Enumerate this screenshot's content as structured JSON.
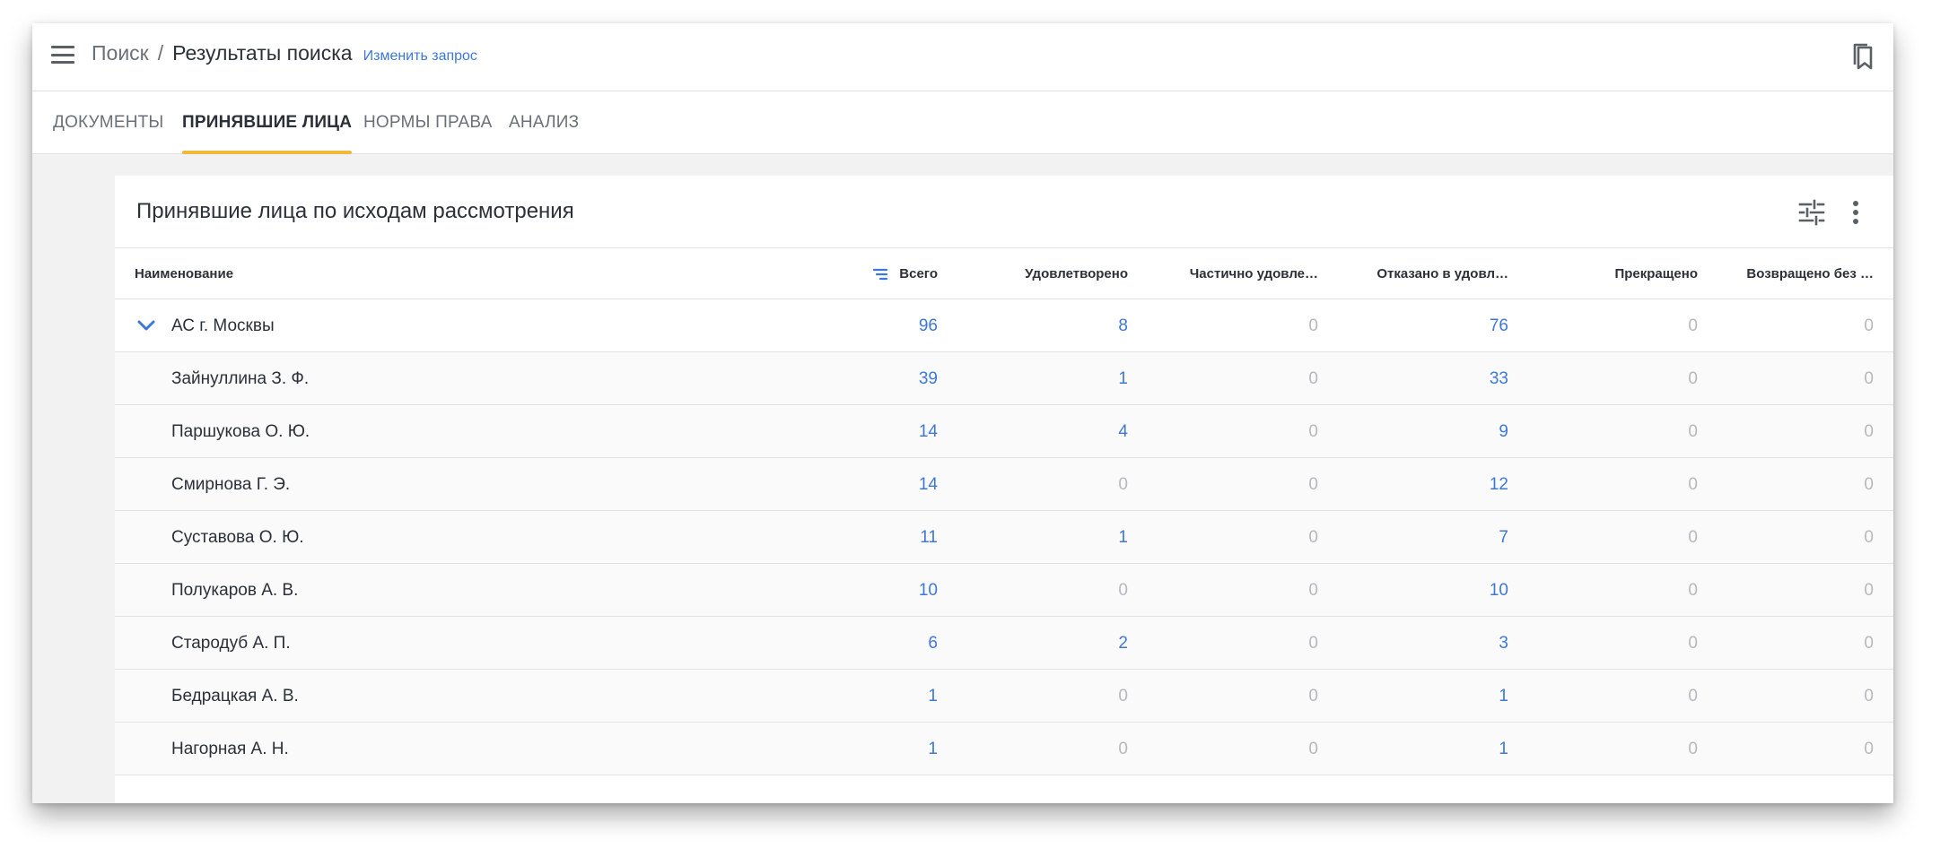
{
  "header": {
    "breadcrumb_root": "Поиск",
    "breadcrumb_sep": "/",
    "breadcrumb_current": "Результаты поиска",
    "edit_link": "Изменить запрос"
  },
  "tabs": [
    {
      "label": "ДОКУМЕНТЫ",
      "active": false
    },
    {
      "label": "ПРИНЯВШИЕ ЛИЦА",
      "active": true
    },
    {
      "label": "НОРМЫ ПРАВА",
      "active": false
    },
    {
      "label": "АНАЛИЗ",
      "active": false
    }
  ],
  "card": {
    "title": "Принявшие лица по исходам рассмотрения"
  },
  "table": {
    "columns": [
      "Наименование",
      "Всего",
      "Удовлетворено",
      "Частично удовле…",
      "Отказано в удовл…",
      "Прекращено",
      "Возвращено без …"
    ],
    "rows": [
      {
        "name": "АС г. Москвы",
        "group": true,
        "values": [
          96,
          8,
          0,
          76,
          0,
          0
        ]
      },
      {
        "name": "Зайнуллина З. Ф.",
        "group": false,
        "values": [
          39,
          1,
          0,
          33,
          0,
          0
        ]
      },
      {
        "name": "Паршукова О. Ю.",
        "group": false,
        "values": [
          14,
          4,
          0,
          9,
          0,
          0
        ]
      },
      {
        "name": "Смирнова Г. Э.",
        "group": false,
        "values": [
          14,
          0,
          0,
          12,
          0,
          0
        ]
      },
      {
        "name": "Суставова О. Ю.",
        "group": false,
        "values": [
          11,
          1,
          0,
          7,
          0,
          0
        ]
      },
      {
        "name": "Полукаров А. В.",
        "group": false,
        "values": [
          10,
          0,
          0,
          10,
          0,
          0
        ]
      },
      {
        "name": "Стародуб А. П.",
        "group": false,
        "values": [
          6,
          2,
          0,
          3,
          0,
          0
        ]
      },
      {
        "name": "Бедрацкая А. В.",
        "group": false,
        "values": [
          1,
          0,
          0,
          1,
          0,
          0
        ]
      },
      {
        "name": "Нагорная А. Н.",
        "group": false,
        "values": [
          1,
          0,
          0,
          1,
          0,
          0
        ]
      }
    ]
  },
  "colors": {
    "accent": "#3d78d8",
    "tab_indicator": "#f1b93a",
    "muted_value": "#b5b8bd"
  }
}
